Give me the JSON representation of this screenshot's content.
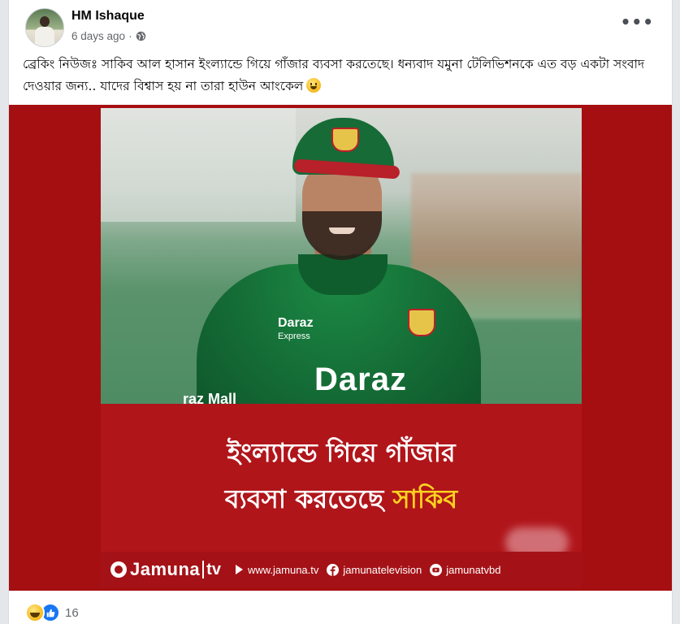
{
  "post": {
    "author": "HM Ishaque",
    "time": "6 days ago",
    "separator": "·",
    "privacy_icon": "globe-icon",
    "more_label": "•••",
    "caption": "ব্রেকিং নিউজঃ সাকিব আল হাসান ইংল্যান্ডে গিয়ে গাঁজার ব্যবসা করতেছে। ধন্যবাদ যমুনা টেলিভিশনকে এত বড় একটা সংবাদ দেওয়ার জন্য.. যাদের বিশ্বাস হয় না তারা হাউন আংকেল",
    "caption_emoji": "grinning-face-icon"
  },
  "image": {
    "sponsor_small": "Daraz",
    "sponsor_small_sub": "Express",
    "sponsor_big": "Daraz",
    "sponsor_side": "raz Mall",
    "headline_line1": "ইংল্যান্ডে গিয়ে গাঁজার",
    "headline_line2_prefix": "ব্যবসা করতেছে ",
    "headline_line2_highlight": "সাকিব",
    "brand": "Jamuna",
    "brand_tv": "tv",
    "website": "www.jamuna.tv",
    "facebook": "jamunatelevision",
    "youtube": "jamunatvbd",
    "colors": {
      "banner_red": "#b0151a",
      "highlight_yellow": "#ffd21f"
    }
  },
  "reactions": {
    "icons": [
      "haha-reaction-icon",
      "like-reaction-icon"
    ],
    "count": "16"
  }
}
